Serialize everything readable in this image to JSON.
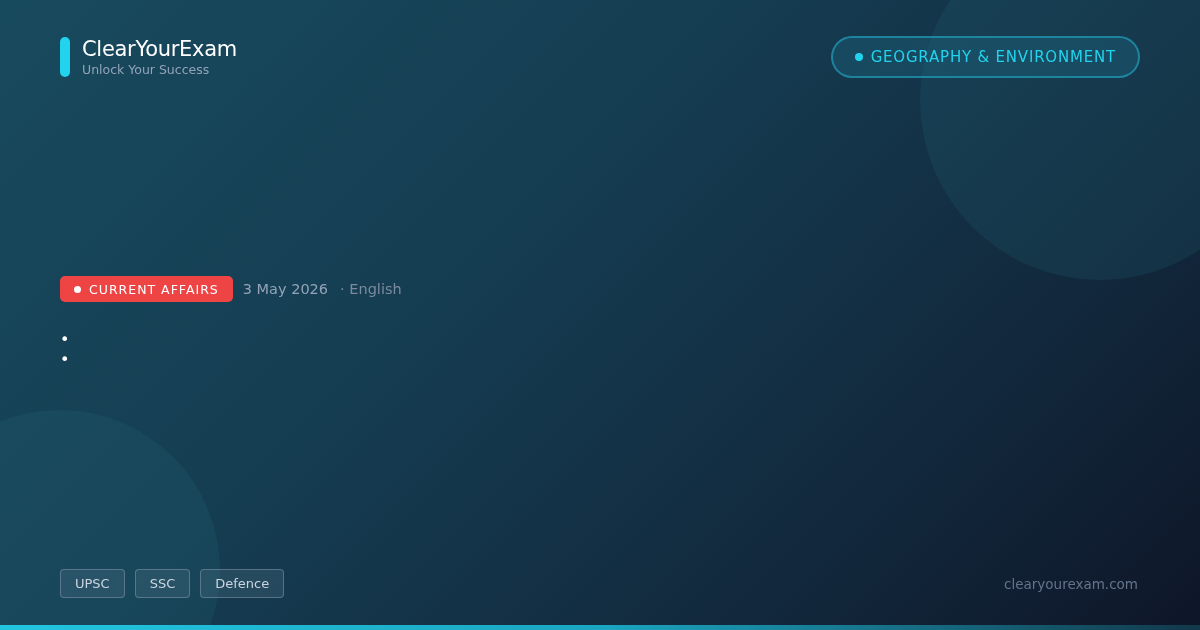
{
  "brand": {
    "name": "ClearYourExam",
    "tagline": "Unlock Your Success"
  },
  "topic_badge": {
    "label": "GEOGRAPHY & ENVIRONMENT"
  },
  "meta": {
    "category": "CURRENT AFFAIRS",
    "date": "3 May 2026",
    "language": "· English"
  },
  "bullets": [
    "•",
    "•"
  ],
  "exam_tags": [
    "UPSC",
    "SSC",
    "Defence"
  ],
  "site": "clearyourexam.com"
}
